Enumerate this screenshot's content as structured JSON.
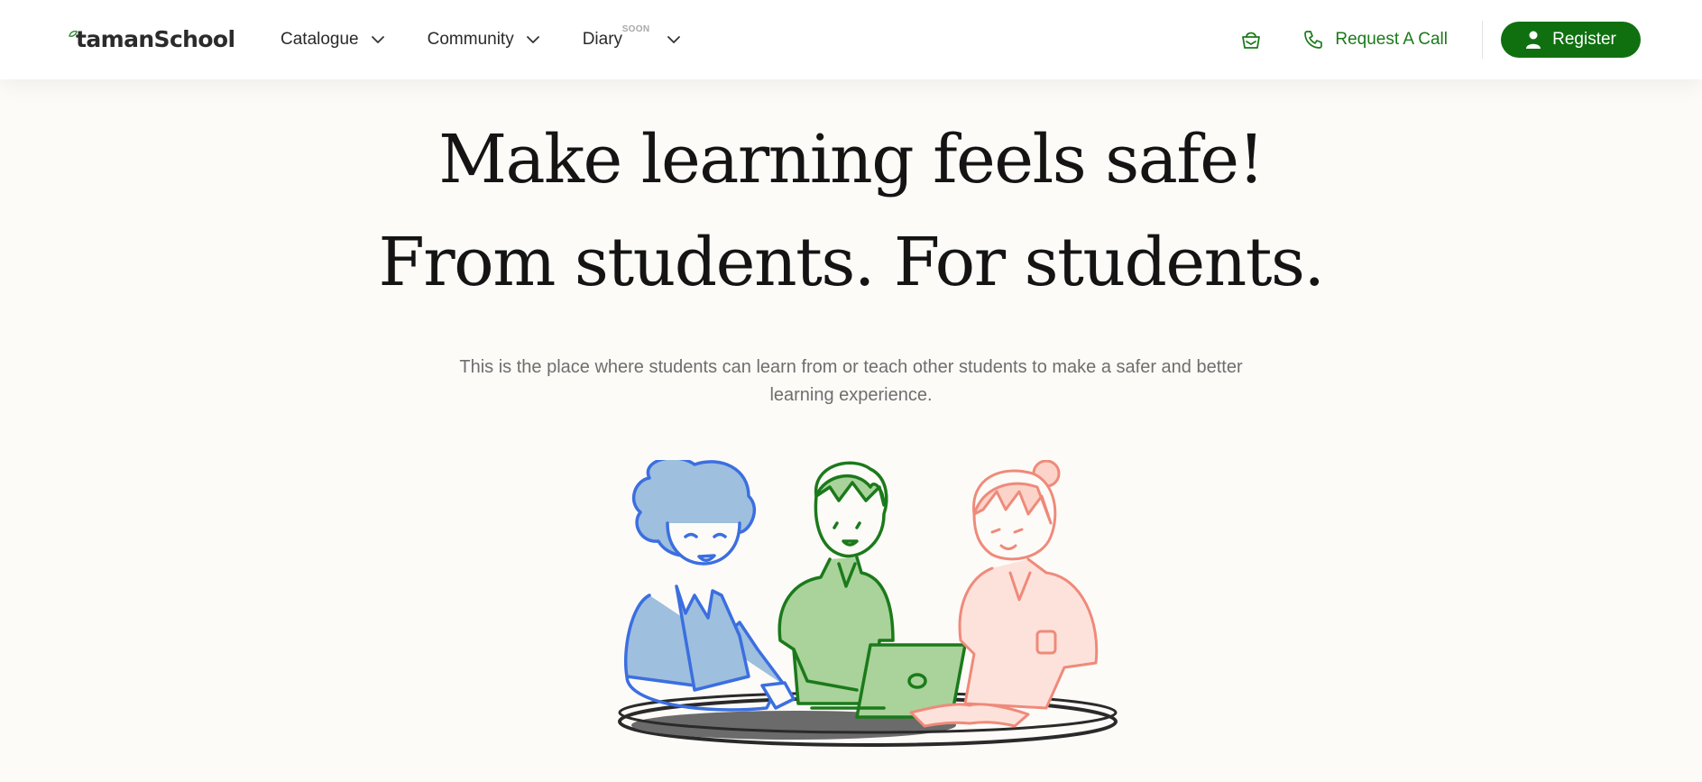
{
  "brand": {
    "name": "tamanSchool",
    "accent": "#107010"
  },
  "nav": {
    "items": [
      {
        "label": "Catalogue",
        "icon": "chevron-down-icon"
      },
      {
        "label": "Community",
        "icon": "chevron-down-icon"
      },
      {
        "label": "Diary",
        "badge": "SOON",
        "icon": "chevron-down-icon"
      }
    ]
  },
  "actions": {
    "basket_icon": "basket-icon",
    "call_label": "Request A Call",
    "register_label": "Register"
  },
  "hero": {
    "headline_line1": "Make learning feels safe!",
    "headline_line2": "From students. For students.",
    "subtext": "This is the place where students can learn from or teach other students to make a safer and better learning experience."
  },
  "colors": {
    "background": "#fdfbf8",
    "green": "#107010",
    "blue": "#3b6fe0",
    "pink": "#ef8a7a"
  }
}
